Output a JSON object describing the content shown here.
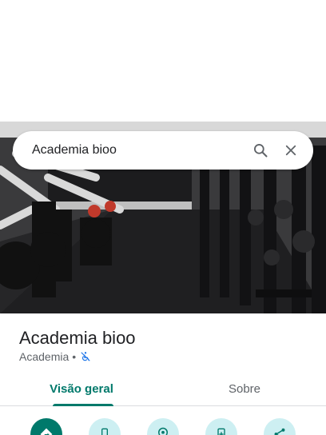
{
  "search": {
    "query": "Academia bioo"
  },
  "photo": {
    "subject": "gym interior with weight machines and power racks"
  },
  "place": {
    "name": "Academia bioo",
    "category": "Academia",
    "separator": "•"
  },
  "tabs": [
    {
      "label": "Visão geral",
      "active": true
    },
    {
      "label": "Sobre",
      "active": false
    }
  ],
  "actions": [
    {
      "icon": "directions-icon",
      "primary": true
    },
    {
      "icon": "phone-icon",
      "primary": false
    },
    {
      "icon": "save-location-icon",
      "primary": false
    },
    {
      "icon": "add-to-device-icon",
      "primary": false
    },
    {
      "icon": "share-icon",
      "primary": false
    }
  ],
  "colors": {
    "accent": "#00796b",
    "action_bg": "#cdeff2",
    "accessibility_icon": "#1a73e8"
  }
}
